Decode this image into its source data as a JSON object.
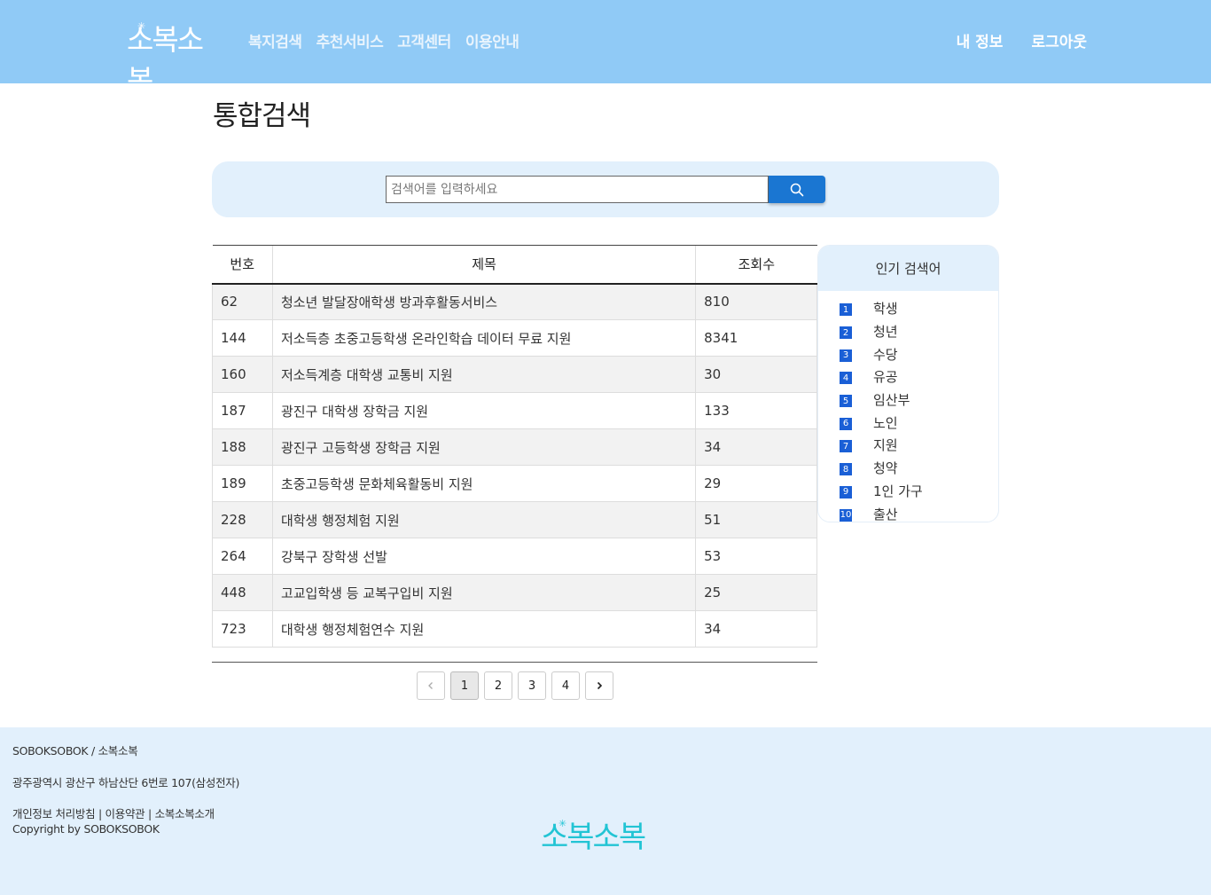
{
  "header": {
    "logo": "소복소복",
    "nav": [
      "복지검색",
      "추천서비스",
      "고객센터",
      "이용안내"
    ],
    "user_menu": [
      "내 정보",
      "로그아웃"
    ]
  },
  "page_title": "통합검색",
  "search": {
    "placeholder": "검색어를 입력하세요",
    "button_icon": "search-icon"
  },
  "table": {
    "headers": [
      "번호",
      "제목",
      "조회수"
    ],
    "rows": [
      {
        "no": "62",
        "title": "청소년 발달장애학생 방과후활동서비스",
        "views": "810"
      },
      {
        "no": "144",
        "title": "저소득층 초중고등학생 온라인학습 데이터 무료 지원",
        "views": "8341"
      },
      {
        "no": "160",
        "title": "저소득계층 대학생 교통비 지원",
        "views": "30"
      },
      {
        "no": "187",
        "title": "광진구 대학생 장학금 지원",
        "views": "133"
      },
      {
        "no": "188",
        "title": "광진구 고등학생 장학금 지원",
        "views": "34"
      },
      {
        "no": "189",
        "title": "초중고등학생 문화체육활동비 지원",
        "views": "29"
      },
      {
        "no": "228",
        "title": "대학생 행정체험 지원",
        "views": "51"
      },
      {
        "no": "264",
        "title": "강북구 장학생 선발",
        "views": "53"
      },
      {
        "no": "448",
        "title": "고교입학생 등 교복구입비 지원",
        "views": "25"
      },
      {
        "no": "723",
        "title": "대학생 행정체험연수 지원",
        "views": "34"
      }
    ]
  },
  "popular": {
    "title": "인기 검색어",
    "items": [
      {
        "rank": "1",
        "keyword": "학생"
      },
      {
        "rank": "2",
        "keyword": "청년"
      },
      {
        "rank": "3",
        "keyword": "수당"
      },
      {
        "rank": "4",
        "keyword": "유공"
      },
      {
        "rank": "5",
        "keyword": "임산부"
      },
      {
        "rank": "6",
        "keyword": "노인"
      },
      {
        "rank": "7",
        "keyword": "지원"
      },
      {
        "rank": "8",
        "keyword": "청약"
      },
      {
        "rank": "9",
        "keyword": "1인 가구"
      },
      {
        "rank": "10",
        "keyword": "출산"
      }
    ]
  },
  "pagination": {
    "pages": [
      "1",
      "2",
      "3",
      "4"
    ],
    "current": "1"
  },
  "footer": {
    "company": "SOBOKSOBOK / 소복소복",
    "address": "광주광역시 광산구 하남산단 6번로 107(삼성전자)",
    "links": [
      "개인정보 처리방침",
      "이용약관",
      "소복소복소개"
    ],
    "copyright": "Copyright by SOBOKSOBOK",
    "logo": "소복소복"
  },
  "colors": {
    "header_bg": "#90caf6",
    "light_bg": "#e2f0fc",
    "accent": "#1a76d2",
    "rank_badge": "#1a5fd6",
    "footer_logo": "#22c4d4"
  }
}
